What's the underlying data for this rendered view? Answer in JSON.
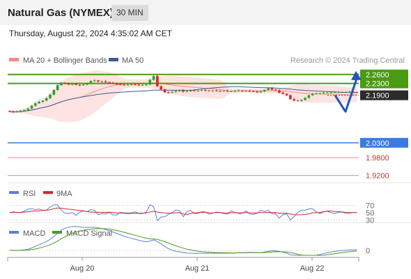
{
  "header": {
    "title": "Natural Gas (NYMEX)",
    "timeframe": "30 MIN",
    "timestamp": "Thursday, August 22, 2024 4:35:02 AM CET"
  },
  "colors": {
    "candle_up": "#2ca02c",
    "candle_down": "#d62728",
    "ma20": "#f28b82",
    "bollinger_fill": "#fde3e1",
    "ma50": "#3c5a99",
    "resistance": "#4a9a12",
    "support": "#3b7be0",
    "support_minor": "#e88a8a",
    "forecast_arrow": "#1f57b8",
    "rsi": "#5b7fe0",
    "rsi_ma": "#d62728",
    "macd": "#5b7fe0",
    "macd_signal": "#4a9a12",
    "current_price_bg": "#2b2b2b"
  },
  "chart_data": [
    {
      "type": "candlestick",
      "title": "Natural Gas (NYMEX)",
      "timeframe": "30 MIN",
      "legend": [
        "MA 20 + Bollinger Bands",
        "MA 50"
      ],
      "watermark": "Research © 2024 Trading Central",
      "x_labels": [
        "Aug 20",
        "Aug 21",
        "Aug 22"
      ],
      "ylim": [
        1.905,
        2.283
      ],
      "current_price": 2.19,
      "levels": [
        {
          "value": 2.26,
          "label": "2.2600",
          "kind": "resistance"
        },
        {
          "value": 2.23,
          "label": "2.2300",
          "kind": "resistance"
        },
        {
          "value": 2.03,
          "label": "2.0300",
          "kind": "support"
        },
        {
          "value": 1.98,
          "label": "1.9800",
          "kind": "support-minor"
        },
        {
          "value": 1.92,
          "label": "1.9200",
          "kind": "support-minor"
        }
      ],
      "current_price_label": "2.1900",
      "forecast": {
        "from": 2.19,
        "down_to": 2.135,
        "up_to": 2.26
      },
      "candle_count": 95,
      "close": [
        2.135,
        2.134,
        2.135,
        2.138,
        2.14,
        2.145,
        2.155,
        2.163,
        2.168,
        2.172,
        2.18,
        2.192,
        2.208,
        2.224,
        2.232,
        2.23,
        2.226,
        2.228,
        2.225,
        2.224,
        2.226,
        2.231,
        2.238,
        2.24,
        2.236,
        2.237,
        2.234,
        2.232,
        2.229,
        2.227,
        2.226,
        2.224,
        2.226,
        2.227,
        2.226,
        2.224,
        2.225,
        2.226,
        2.242,
        2.255,
        2.22,
        2.21,
        2.2,
        2.199,
        2.201,
        2.204,
        2.207,
        2.202,
        2.204,
        2.206,
        2.205,
        2.206,
        2.207,
        2.206,
        2.205,
        2.206,
        2.205,
        2.204,
        2.205,
        2.203,
        2.204,
        2.205,
        2.206,
        2.204,
        2.205,
        2.204,
        2.203,
        2.2,
        2.203,
        2.208,
        2.214,
        2.209,
        2.207,
        2.199,
        2.195,
        2.19,
        2.177,
        2.172,
        2.171,
        2.174,
        2.181,
        2.19,
        2.195,
        2.196,
        2.197,
        2.199,
        2.199,
        2.2,
        2.201,
        2.201,
        2.2,
        2.201,
        2.202,
        2.2,
        2.199
      ]
    },
    {
      "type": "line",
      "title": "RSI",
      "series": [
        {
          "name": "RSI"
        },
        {
          "name": "9MA"
        }
      ],
      "levels": [
        {
          "value": 70,
          "label": "70"
        },
        {
          "value": 50,
          "label": "50"
        },
        {
          "value": 30,
          "label": "30"
        }
      ],
      "ylim": [
        25,
        75
      ]
    },
    {
      "type": "line",
      "title": "MACD",
      "series": [
        {
          "name": "MACD"
        },
        {
          "name": "MACD Signal"
        }
      ],
      "levels": [
        {
          "value": 0,
          "label": "0"
        }
      ]
    }
  ]
}
